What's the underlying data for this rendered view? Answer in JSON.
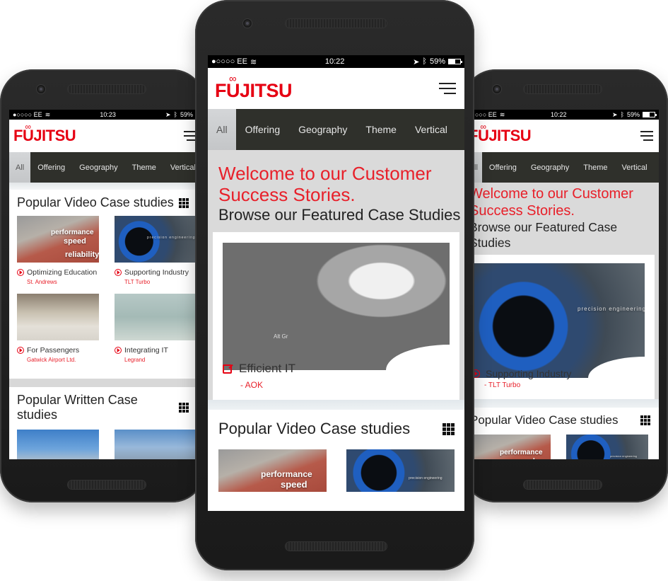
{
  "brand": {
    "logo_text": "FUJITSU",
    "accent_color": "#e60012",
    "tab_bg": "#2f302b"
  },
  "phones": {
    "left": {
      "status": {
        "carrier": "●○○○○ EE",
        "time": "10:23",
        "battery": "59%",
        "battery_fraction": 0.59
      },
      "tabs": [
        "All",
        "Offering",
        "Geography",
        "Theme",
        "Vertical"
      ],
      "active_tab": "All",
      "sections": [
        {
          "title": "Popular Video Case studies",
          "items": [
            {
              "title": "Optimizing Education",
              "client": "St. Andrews",
              "overlay": [
                "performance",
                "speed",
                "reliability"
              ]
            },
            {
              "title": "Supporting Industry",
              "client": "TLT Turbo",
              "overlay": [
                "precision engineering"
              ]
            },
            {
              "title": "For Passengers",
              "client": "Gatwick Airport Ltd."
            },
            {
              "title": "Integrating IT",
              "client": "Legrand"
            }
          ]
        },
        {
          "title": "Popular Written Case studies",
          "items": []
        }
      ]
    },
    "center": {
      "status": {
        "carrier": "●○○○○ EE",
        "time": "10:22",
        "battery": "59%",
        "battery_fraction": 0.59
      },
      "tabs": [
        "All",
        "Offering",
        "Geography",
        "Theme",
        "Vertical"
      ],
      "active_tab": "All",
      "hero": {
        "line1": "Welcome to our Customer",
        "line2": "Success Stories.",
        "subtitle": "Browse our Featured Case Studies"
      },
      "featured": {
        "title": "Efficient IT",
        "client": "- AOK",
        "key_label": "Alt Gr"
      },
      "section": {
        "title": "Popular Video Case studies",
        "items": [
          {
            "overlay": [
              "performance",
              "speed"
            ]
          },
          {
            "overlay": [
              "precision engineering"
            ]
          }
        ]
      }
    },
    "right": {
      "status": {
        "carrier": "○○○ EE",
        "time": "10:22",
        "battery": "59%",
        "battery_fraction": 0.59
      },
      "tabs": [
        "ll",
        "Offering",
        "Geography",
        "Theme",
        "Vertical"
      ],
      "active_tab": "All",
      "hero": {
        "line1": "Welcome to our Customer",
        "line2": "Success Stories.",
        "subtitle": "Browse our Featured Case Studies"
      },
      "featured": {
        "title": "Supporting Industry",
        "client": "- TLT Turbo",
        "overlay": "precision engineering"
      },
      "section": {
        "title": "Popular Video Case studies",
        "items": [
          {
            "overlay": [
              "performance",
              "speed"
            ]
          },
          {
            "overlay": [
              "precision engineering"
            ]
          }
        ]
      }
    }
  }
}
